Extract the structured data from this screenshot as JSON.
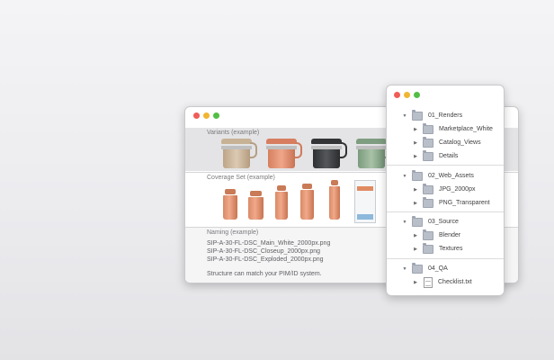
{
  "main_window": {
    "variants_label": "Variants (example)",
    "coverage_label": "Coverage Set (example)",
    "naming_label": "Naming (example)",
    "filenames": [
      "SIP-A-30-FL-DSC_Main_White_2000px.png",
      "SIP-A-30-FL-DSC_Closeup_2000px.png",
      "SIP-A-30-FL-DSC_Exploded_2000px.png"
    ],
    "note": "Structure can match your PIM/ID system.",
    "variant_colors": [
      "#cbb59d",
      "#e08d6f",
      "#3c3e40",
      "#8aa88a"
    ]
  },
  "folder_window": {
    "groups": [
      {
        "name": "01_Renders",
        "children": [
          "Marketplace_White",
          "Catalog_Views",
          "Details"
        ]
      },
      {
        "name": "02_Web_Assets",
        "children": [
          "JPG_2000px",
          "PNG_Transparent"
        ]
      },
      {
        "name": "03_Source",
        "children": [
          "Blender",
          "Textures"
        ]
      },
      {
        "name": "04_QA",
        "files": [
          "Checklist.txt"
        ]
      }
    ]
  }
}
